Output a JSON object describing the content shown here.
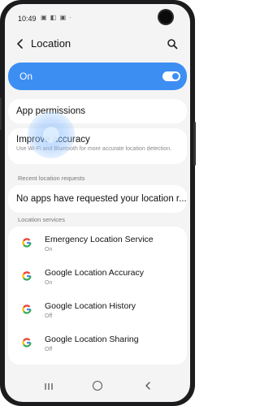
{
  "status_bar": {
    "time": "10:49",
    "icons": "▣ ◧ ▣ ·"
  },
  "header": {
    "title": "Location"
  },
  "toggle_row": {
    "label": "On",
    "state": "on"
  },
  "app_permissions": {
    "title": "App permissions"
  },
  "improve_accuracy": {
    "title": "Improve accuracy",
    "subtitle": "Use Wi-Fi and Bluetooth for more accurate location detection."
  },
  "recent_requests": {
    "header": "Recent location requests",
    "message": "No apps have requested your location r..."
  },
  "location_services": {
    "header": "Location services",
    "items": [
      {
        "title": "Emergency Location Service",
        "status": "On"
      },
      {
        "title": "Google Location Accuracy",
        "status": "On"
      },
      {
        "title": "Google Location History",
        "status": "Off"
      },
      {
        "title": "Google Location Sharing",
        "status": "Off"
      }
    ]
  },
  "colors": {
    "accent": "#3c8ef3",
    "background": "#f4f4f4",
    "card": "#ffffff"
  },
  "icons": [
    "back-arrow-icon",
    "search-icon",
    "google-g-icon",
    "recent-apps-icon",
    "home-icon",
    "nav-back-icon"
  ]
}
